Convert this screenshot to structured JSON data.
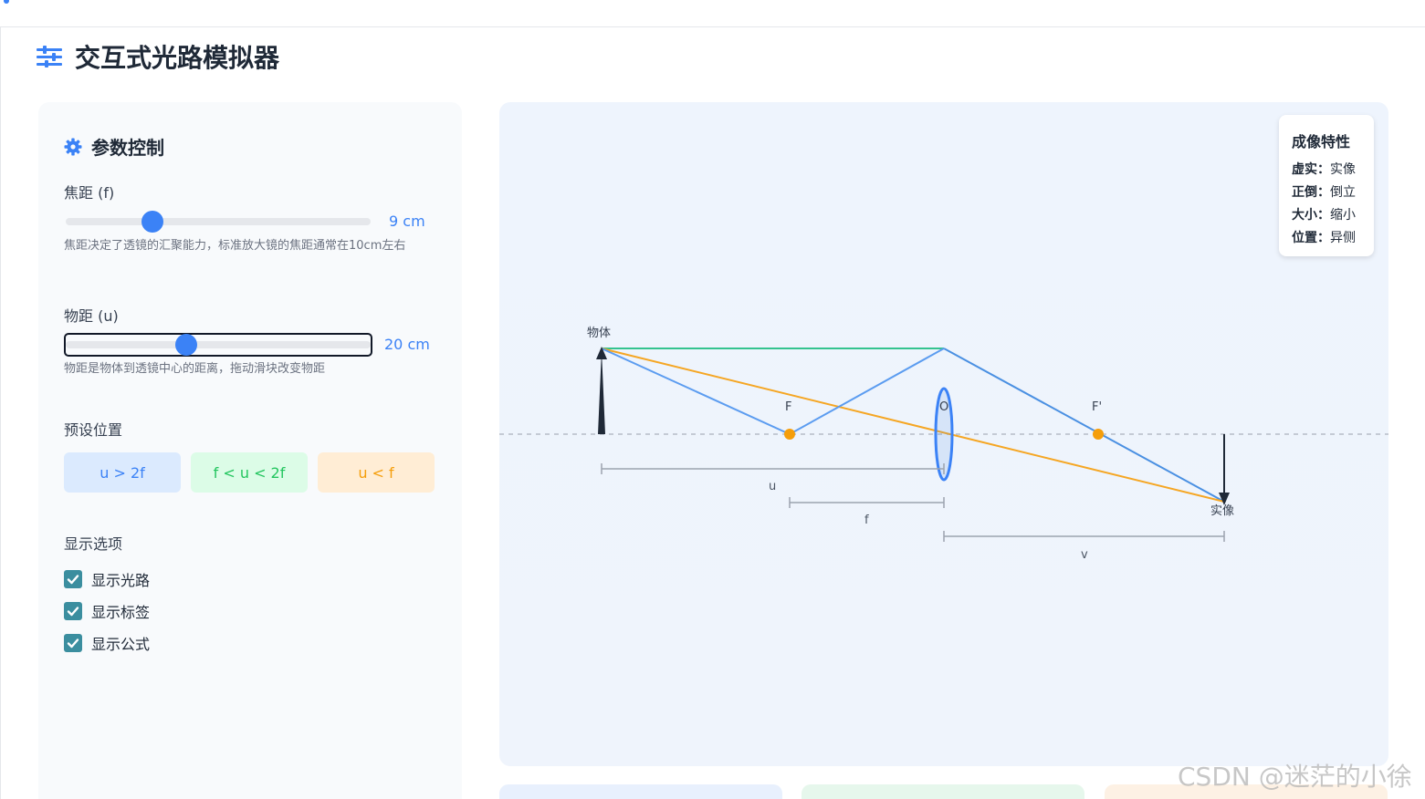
{
  "app": {
    "title": "交互式光路模拟器"
  },
  "panel": {
    "title": "参数控制",
    "focal": {
      "label": "焦距 (f)",
      "value_text": "9 cm",
      "value": 9,
      "description": "焦距决定了透镜的汇聚能力，标准放大镜的焦距通常在10cm左右"
    },
    "object_distance": {
      "label": "物距 (u)",
      "value_text": "20 cm",
      "value": 20,
      "description": "物距是物体到透镜中心的距离，拖动滑块改变物距"
    },
    "presets": {
      "label": "预设位置",
      "items": [
        "u > 2f",
        "f < u < 2f",
        "u < f"
      ]
    },
    "display": {
      "label": "显示选项",
      "options": [
        {
          "label": "显示光路",
          "checked": true
        },
        {
          "label": "显示标签",
          "checked": true
        },
        {
          "label": "显示公式",
          "checked": true
        }
      ]
    }
  },
  "info": {
    "title": "成像特性",
    "rows": [
      {
        "key": "虚实：",
        "value": "实像"
      },
      {
        "key": "正倒：",
        "value": "倒立"
      },
      {
        "key": "大小：",
        "value": "缩小"
      },
      {
        "key": "位置：",
        "value": "异侧"
      }
    ]
  },
  "diagram": {
    "object_label": "物体",
    "image_label": "实像",
    "focus_left_label": "F",
    "focus_right_label": "F'",
    "center_label": "O",
    "u_label": "u",
    "f_label": "f",
    "v_label": "v"
  },
  "colors": {
    "accent": "#3b82f6",
    "green_ray": "#34c38f",
    "orange_ray": "#f5a623",
    "blue_ray": "#4a90e2",
    "focus_point": "#f59e0b"
  },
  "watermark": "CSDN @迷茫的小徐"
}
